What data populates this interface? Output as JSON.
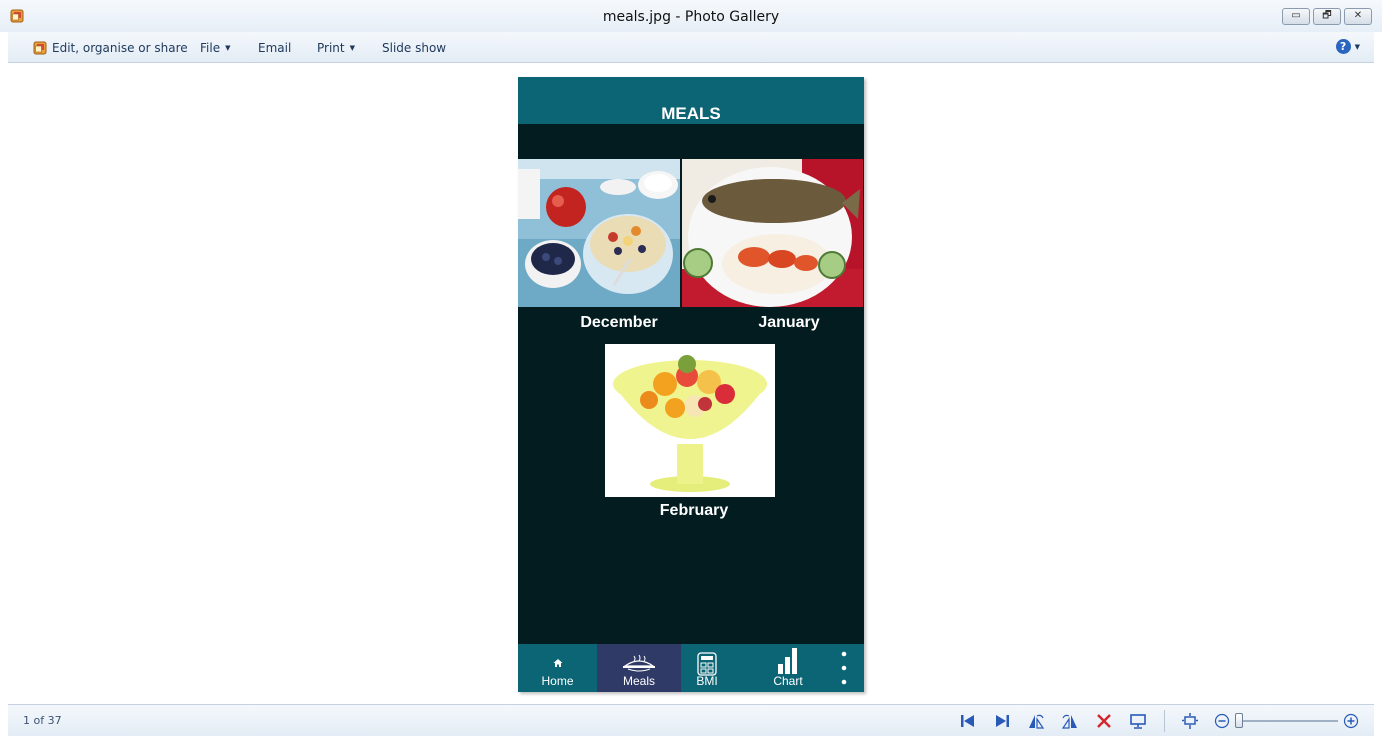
{
  "window": {
    "title": "meals.jpg - Photo Gallery",
    "controls": {
      "minimize": "▭",
      "restore": "🗗",
      "close": "✕"
    }
  },
  "toolbar": {
    "edit_label": "Edit, organise or share",
    "file_label": "File",
    "email_label": "Email",
    "print_label": "Print",
    "slideshow_label": "Slide show",
    "help_label": "?"
  },
  "status": {
    "page_count": "1 of 37",
    "icons": [
      "previous-icon",
      "next-icon",
      "rotate-left-icon",
      "rotate-right-icon",
      "delete-icon",
      "slideshow-icon",
      "fit-icon",
      "zoom-out-icon",
      "zoom-in-icon"
    ]
  },
  "photo": {
    "app_title": "MEALS",
    "tiles": [
      {
        "label": "December",
        "image": "breakfast-cereal-fruit"
      },
      {
        "label": "January",
        "image": "grilled-fish-with-rice"
      },
      {
        "label": "February",
        "image": "fruit-salad-bowl"
      }
    ],
    "nav": [
      {
        "label": "Home",
        "icon": "home-icon",
        "active": false
      },
      {
        "label": "Meals",
        "icon": "dish-icon",
        "active": true
      },
      {
        "label": "BMI",
        "icon": "calculator-icon",
        "active": false
      },
      {
        "label": "Chart",
        "icon": "bar-chart-icon",
        "active": false
      },
      {
        "label": "",
        "icon": "more-vertical-icon",
        "active": false
      }
    ],
    "colors": {
      "header": "#0c6575",
      "body": "#021c20",
      "active_tab": "#2f3a66"
    }
  }
}
